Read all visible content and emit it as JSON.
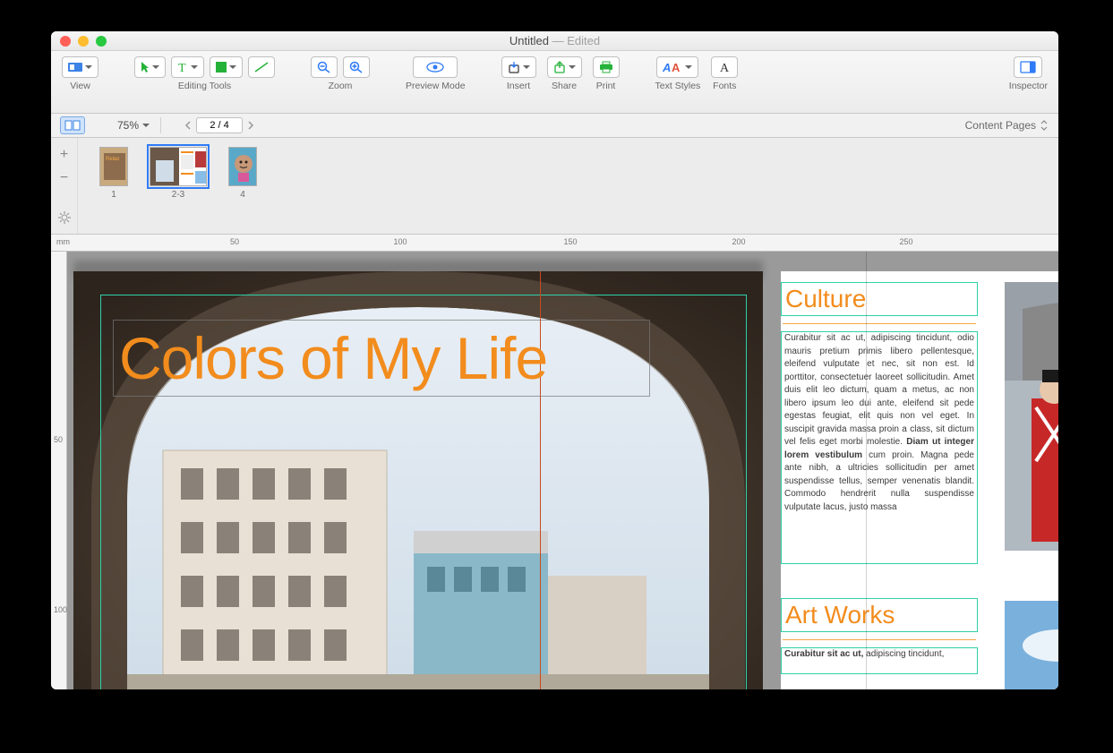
{
  "window": {
    "title": "Untitled",
    "edited": " — Edited"
  },
  "toolbar": {
    "view": "View",
    "editing_tools": "Editing Tools",
    "zoom": "Zoom",
    "preview_mode": "Preview Mode",
    "insert": "Insert",
    "share": "Share",
    "print": "Print",
    "text_styles": "Text Styles",
    "fonts": "Fonts",
    "inspector": "Inspector"
  },
  "secondbar": {
    "zoom": "75%",
    "page_field": "2 / 4",
    "right_label": "Content Pages"
  },
  "thumbs": [
    {
      "label": "1"
    },
    {
      "label": "2-3"
    },
    {
      "label": "4"
    }
  ],
  "ruler_unit": "mm",
  "ruler_marks": [
    "50",
    "100",
    "150",
    "200",
    "250"
  ],
  "vruler_marks": [
    "50",
    "100"
  ],
  "page2": {
    "title": "Colors of My Life"
  },
  "page3": {
    "sections": [
      {
        "title": "Culture",
        "body_a": "Curabitur sit ac ut, adipiscing tincidunt, odio mauris pretium primis libero pellentesque, eleifend vulputate et nec, sit non est. Id porttitor, consectetuer laoreet sollicitudin. Amet duis elit leo dictum, quam a metus, ac non libero ipsum leo dui ante, eleifend sit pede egestas feugiat, elit quis non vel eget. In suscipit gravida massa proin a class, sit dictum vel felis eget morbi molestie. ",
        "bold": "Diam ut integer lorem vestibulum",
        "body_b": " cum proin. Magna pede ante nibh, a ultricies sollicitudin per amet suspendisse tellus, semper venenatis blandit. Commodo hendrerit nulla suspendisse vulputate lacus, justo massa"
      },
      {
        "title": "Art Works",
        "bold": "Curabitur sit ac ut,",
        "body_a": " adipiscing tincidunt,"
      }
    ]
  },
  "colors": {
    "accent": "#f28c1d",
    "guide": "#2fd0a8"
  }
}
